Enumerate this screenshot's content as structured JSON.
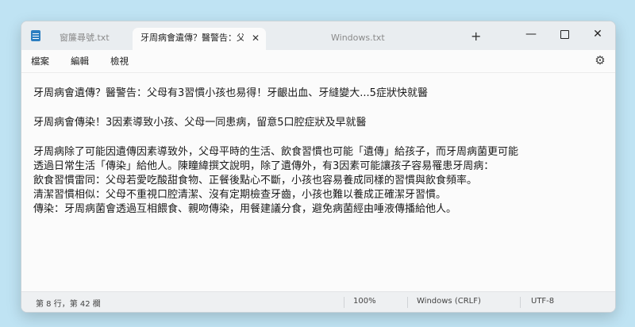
{
  "titlebar": {
    "tabs": [
      {
        "label": "窗簾尋號.txt"
      },
      {
        "label": "牙周病會遺傳？醫警告：父"
      },
      {
        "label": "Windows.txt"
      }
    ],
    "close_glyph": "✕",
    "new_tab_glyph": "+",
    "minimize_glyph": "—",
    "close_window_glyph": "✕"
  },
  "menu": {
    "items": [
      "檔案",
      "編輯",
      "檢視"
    ],
    "settings_glyph": "⚙"
  },
  "editor": {
    "lines": [
      "牙周病會遺傳？醫警告：父母有3習慣小孩也易得！牙齦出血、牙縫變大...5症狀快就醫",
      "",
      "牙周病會傳染！3因素導致小孩、父母一同患病，留意5口腔症狀及早就醫",
      "",
      "牙周病除了可能因遺傳因素導致外，父母平時的生活、飲食習慣也可能「遺傳」給孩子，而牙周病菌更可能",
      "透過日常生活「傳染」給他人。陳瞳緯撰文說明，除了遺傳外，有3因素可能讓孩子容易罹患牙周病：",
      "飲食習慣雷同：父母若愛吃酸甜食物、正餐後點心不斷，小孩也容易養成同樣的習慣與飲食頻率。",
      "清潔習慣相似：父母不重視口腔清潔、沒有定期檢查牙齒，小孩也難以養成正確潔牙習慣。",
      "傳染：牙周病菌會透過互相餵食、親吻傳染，用餐建議分食，避免病菌經由唾液傳播給他人。"
    ]
  },
  "status": {
    "position": "第 8 行，第 42 欄",
    "zoom": "100%",
    "line_ending": "Windows (CRLF)",
    "encoding": "UTF-8"
  }
}
